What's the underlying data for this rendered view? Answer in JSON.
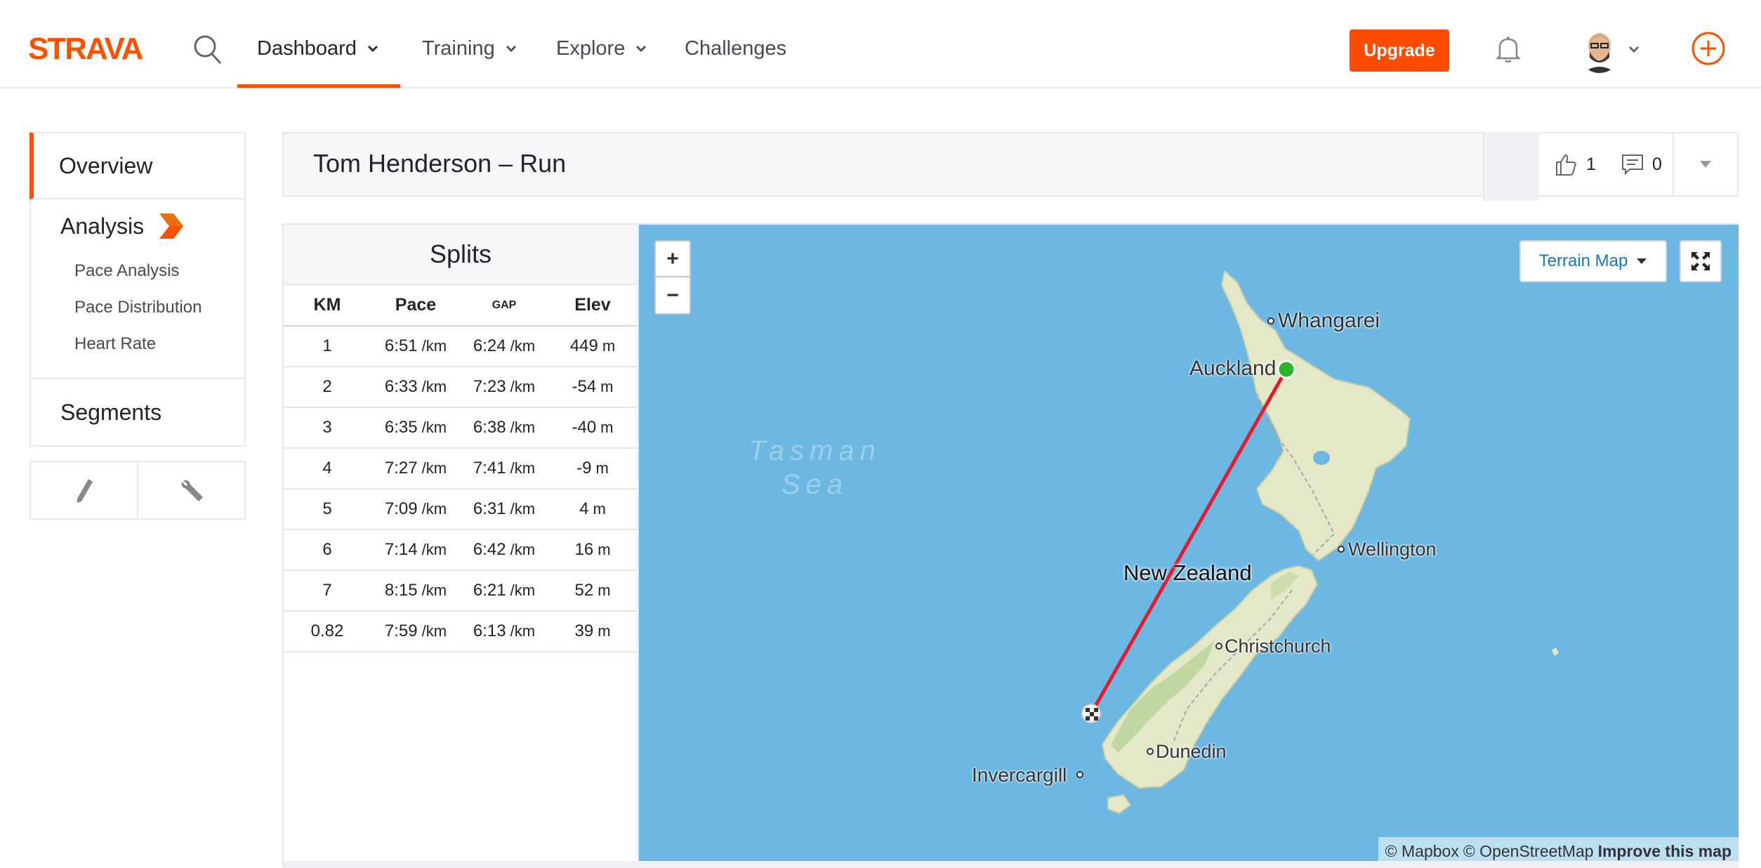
{
  "brand": {
    "name": "STRAVA",
    "color": "#fc5200"
  },
  "nav": {
    "items": [
      {
        "label": "Dashboard",
        "has_dropdown": true,
        "active": true
      },
      {
        "label": "Training",
        "has_dropdown": true
      },
      {
        "label": "Explore",
        "has_dropdown": true
      },
      {
        "label": "Challenges",
        "has_dropdown": false
      }
    ],
    "upgrade_label": "Upgrade",
    "icons": [
      "search-icon",
      "bell-icon",
      "avatar",
      "add-icon"
    ]
  },
  "sidebar": {
    "overview": "Overview",
    "analysis": "Analysis",
    "analysis_items": [
      "Pace Analysis",
      "Pace Distribution",
      "Heart Rate"
    ],
    "segments": "Segments",
    "tools": [
      "pencil-icon",
      "wrench-icon"
    ]
  },
  "activity": {
    "title": "Tom Henderson – Run",
    "kudos_count": "1",
    "comment_count": "0"
  },
  "splits": {
    "title": "Splits",
    "headers": [
      "KM",
      "Pace",
      "GAP",
      "Elev"
    ],
    "rows": [
      {
        "km": "1",
        "pace": "6:51",
        "pace_unit": "/km",
        "gap": "6:24",
        "gap_unit": "/km",
        "elev": "449",
        "elev_unit": "m"
      },
      {
        "km": "2",
        "pace": "6:33",
        "pace_unit": "/km",
        "gap": "7:23",
        "gap_unit": "/km",
        "elev": "-54",
        "elev_unit": "m"
      },
      {
        "km": "3",
        "pace": "6:35",
        "pace_unit": "/km",
        "gap": "6:38",
        "gap_unit": "/km",
        "elev": "-40",
        "elev_unit": "m"
      },
      {
        "km": "4",
        "pace": "7:27",
        "pace_unit": "/km",
        "gap": "7:41",
        "gap_unit": "/km",
        "elev": "-9",
        "elev_unit": "m"
      },
      {
        "km": "5",
        "pace": "7:09",
        "pace_unit": "/km",
        "gap": "6:31",
        "gap_unit": "/km",
        "elev": "4",
        "elev_unit": "m"
      },
      {
        "km": "6",
        "pace": "7:14",
        "pace_unit": "/km",
        "gap": "6:42",
        "gap_unit": "/km",
        "elev": "16",
        "elev_unit": "m"
      },
      {
        "km": "7",
        "pace": "8:15",
        "pace_unit": "/km",
        "gap": "6:21",
        "gap_unit": "/km",
        "elev": "52",
        "elev_unit": "m"
      },
      {
        "km": "0.82",
        "pace": "7:59",
        "pace_unit": "/km",
        "gap": "6:13",
        "gap_unit": "/km",
        "elev": "39",
        "elev_unit": "m"
      }
    ]
  },
  "map": {
    "zoom_in": "+",
    "zoom_out": "−",
    "style_selector": "Terrain Map",
    "sea_label": "Tasman\nSea",
    "country_label": "New Zealand",
    "places": {
      "whangarei": "Whangarei",
      "auckland": "Auckland",
      "wellington": "Wellington",
      "christchurch": "Christchurch",
      "dunedin": "Dunedin",
      "invercargill": "Invercargill"
    },
    "attribution": {
      "mapbox": "© Mapbox",
      "osm": "© OpenStreetMap",
      "improve": "Improve this map"
    },
    "colors": {
      "water": "#6cb8e2",
      "land": "#e4e8c8",
      "route": "#e8192c",
      "start": "#2ab52a"
    }
  }
}
